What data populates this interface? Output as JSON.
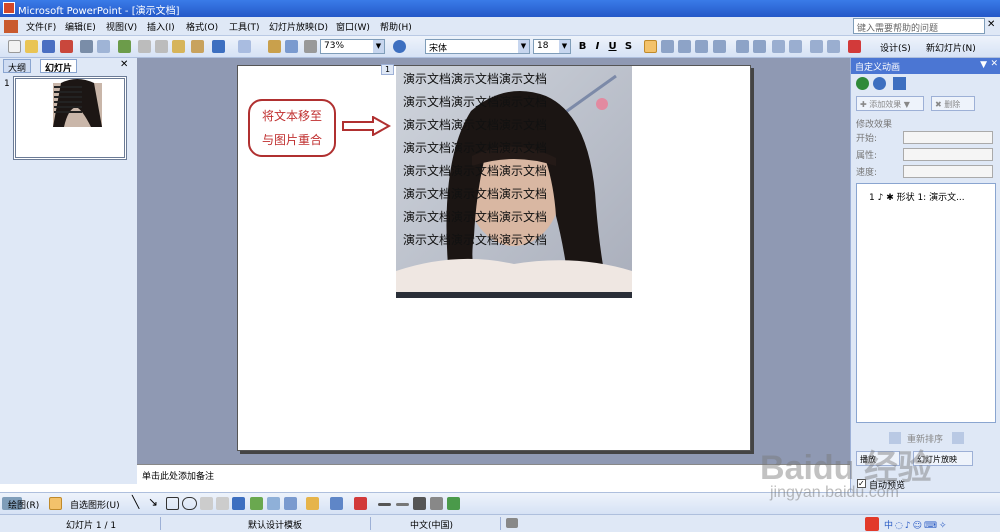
{
  "window": {
    "title": "Microsoft PowerPoint - [演示文档]"
  },
  "menu": {
    "items": [
      "文件(F)",
      "编辑(E)",
      "视图(V)",
      "插入(I)",
      "格式(O)",
      "工具(T)",
      "幻灯片放映(D)",
      "窗口(W)",
      "帮助(H)"
    ],
    "help_placeholder": "键入需要帮助的问题"
  },
  "toolbar": {
    "zoom": "73%",
    "font": "宋体",
    "font_size": "18",
    "bold": "B",
    "italic": "I",
    "underline": "U",
    "shadow": "S",
    "design_label": "设计(S)",
    "new_slide_label": "新幻灯片(N)"
  },
  "left_panel": {
    "tabs": [
      "大纲",
      "幻灯片"
    ],
    "slide_number": "1"
  },
  "slide": {
    "callout_lines": [
      "将文本移至",
      "与图片重合"
    ],
    "text_lines": [
      "演示文档演示文档演示文档",
      "演示文档演示文档演示文档",
      "演示文档演示文档演示文档",
      "演示文档演示文档演示文档",
      "演示文档演示文档演示文档",
      "演示文档演示文档演示文档",
      "演示文档演示文档演示文档",
      "演示文档演示文档演示文档"
    ],
    "badge": "1"
  },
  "notes": {
    "placeholder": "单击此处添加备注"
  },
  "task_pane": {
    "title": "自定义动画",
    "add_effect": "添加效果",
    "delete": "删除",
    "modify_effect": "修改效果",
    "start_label": "开始:",
    "property_label": "属性:",
    "speed_label": "速度:",
    "list_item": "1 ♪ ✱ 形状 1: 演示文...",
    "reorder_label": "重新排序",
    "play_label": "播放",
    "slideshow_label": "幻灯片放映",
    "autopreview_label": "自动预览"
  },
  "draw_toolbar": {
    "draw_label": "绘图(R)",
    "autoshape_label": "自选图形(U)"
  },
  "status": {
    "slide": "幻灯片 1 / 1",
    "template": "默认设计模板",
    "language": "中文(中国)"
  },
  "watermark": {
    "brand": "Baidu 经验",
    "url": "jingyan.baidu.com"
  }
}
